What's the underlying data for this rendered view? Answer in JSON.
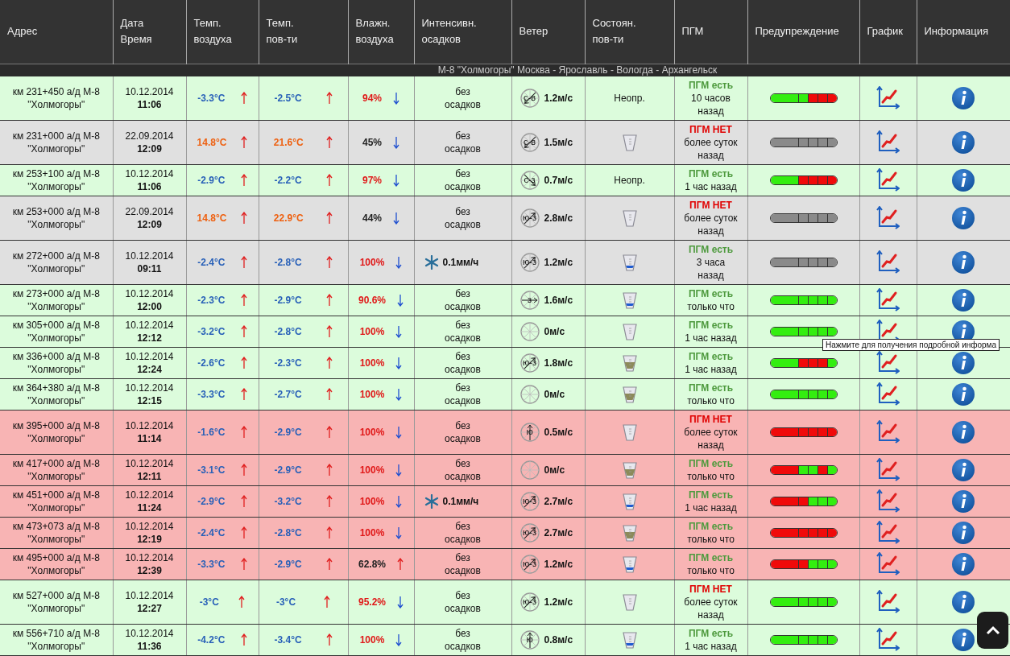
{
  "table": {
    "columns": [
      [
        "Адрес"
      ],
      [
        "Дата",
        "Время"
      ],
      [
        "Темп.",
        "воздуха"
      ],
      [
        "Темп.",
        "пов-ти"
      ],
      [
        "Влажн.",
        "воздуха"
      ],
      [
        "Интенсивн.",
        "осадков"
      ],
      [
        "Ветер"
      ],
      [
        "Состоян.",
        "пов-ти"
      ],
      [
        "ПГМ"
      ],
      [
        "Предупреждение"
      ],
      [
        "График"
      ],
      [
        "Информация"
      ]
    ],
    "group_title": "М-8 \"Холмогоры\" Москва - Ярославль - Вологда - Архангельск",
    "rows": [
      {
        "color": "#dcfcdc",
        "address": [
          "км 231+450 а/д М-8",
          "\"Холмогоры\""
        ],
        "date": "10.12.2014",
        "time": "11:06",
        "air": {
          "value": "-3.3°C",
          "warm": false,
          "rising": true
        },
        "road": {
          "value": "-2.5°C",
          "warm": false,
          "rising": true
        },
        "humidity": {
          "value": "94%",
          "high": true,
          "rising": false
        },
        "precip": {
          "kind": "none",
          "lines": [
            "без",
            "осадков"
          ]
        },
        "wind": {
          "direction": "с-в",
          "kind": "sw",
          "speed": "1.2м/с"
        },
        "surface": {
          "kind": "unknown",
          "text": "Неопр."
        },
        "pgm": {
          "present": true,
          "label": "ПГМ есть",
          "ago": [
            "10 часов",
            "назад"
          ]
        },
        "warning": [
          {
            "color": "#33ee10"
          },
          {
            "color": "#33ee10"
          },
          {
            "color": "#f00a0a"
          },
          {
            "color": "#f00a0a"
          },
          {
            "color": "#f00a0a"
          }
        ]
      },
      {
        "color": "#e0e0e0",
        "address": [
          "км 231+000 а/д М-8",
          "\"Холмогоры\""
        ],
        "date": "22.09.2014",
        "time": "12:09",
        "air": {
          "value": "14.8°C",
          "warm": true,
          "rising": true
        },
        "road": {
          "value": "21.6°C",
          "warm": true,
          "rising": true
        },
        "humidity": {
          "value": "45%",
          "high": false,
          "rising": false
        },
        "precip": {
          "kind": "none",
          "lines": [
            "без",
            "осадков"
          ]
        },
        "wind": {
          "direction": "с-в",
          "kind": "sw",
          "speed": "1.5м/с"
        },
        "surface": {
          "kind": "dry"
        },
        "pgm": {
          "present": false,
          "label": "ПГМ НЕТ",
          "ago": [
            "более суток",
            "назад"
          ]
        },
        "warning": [
          {
            "color": "#8a8a8a"
          },
          {
            "color": "#8a8a8a"
          },
          {
            "color": "#8a8a8a"
          },
          {
            "color": "#8a8a8a"
          },
          {
            "color": "#8a8a8a"
          }
        ]
      },
      {
        "color": "#dcfcdc",
        "address": [
          "км 253+100 а/д М-8",
          "\"Холмогоры\""
        ],
        "date": "10.12.2014",
        "time": "11:06",
        "air": {
          "value": "-2.9°C",
          "warm": false,
          "rising": true
        },
        "road": {
          "value": "-2.2°C",
          "warm": false,
          "rising": true
        },
        "humidity": {
          "value": "97%",
          "high": true,
          "rising": false
        },
        "precip": {
          "kind": "none",
          "lines": [
            "без",
            "осадков"
          ]
        },
        "wind": {
          "direction": "с-з",
          "kind": "se",
          "speed": "0.7м/с"
        },
        "surface": {
          "kind": "unknown",
          "text": "Неопр."
        },
        "pgm": {
          "present": true,
          "label": "ПГМ есть",
          "ago": [
            "1 час назад"
          ]
        },
        "warning": [
          {
            "color": "#33ee10"
          },
          {
            "color": "#f00a0a"
          },
          {
            "color": "#f00a0a"
          },
          {
            "color": "#f00a0a"
          },
          {
            "color": "#f00a0a"
          }
        ]
      },
      {
        "color": "#e0e0e0",
        "address": [
          "км 253+000 а/д М-8",
          "\"Холмогоры\""
        ],
        "date": "22.09.2014",
        "time": "12:09",
        "air": {
          "value": "14.8°C",
          "warm": true,
          "rising": true
        },
        "road": {
          "value": "22.9°C",
          "warm": true,
          "rising": true
        },
        "humidity": {
          "value": "44%",
          "high": false,
          "rising": false
        },
        "precip": {
          "kind": "none",
          "lines": [
            "без",
            "осадков"
          ]
        },
        "wind": {
          "direction": "ю-з",
          "kind": "ne",
          "speed": "2.8м/с"
        },
        "surface": {
          "kind": "dry"
        },
        "pgm": {
          "present": false,
          "label": "ПГМ НЕТ",
          "ago": [
            "более суток",
            "назад"
          ]
        },
        "warning": [
          {
            "color": "#8a8a8a"
          },
          {
            "color": "#8a8a8a"
          },
          {
            "color": "#8a8a8a"
          },
          {
            "color": "#8a8a8a"
          },
          {
            "color": "#8a8a8a"
          }
        ]
      },
      {
        "color": "#e0e0e0",
        "address": [
          "км 272+000 а/д М-8",
          "\"Холмогоры\""
        ],
        "date": "10.12.2014",
        "time": "09:11",
        "air": {
          "value": "-2.4°C",
          "warm": false,
          "rising": true
        },
        "road": {
          "value": "-2.8°C",
          "warm": false,
          "rising": true
        },
        "humidity": {
          "value": "100%",
          "high": true,
          "rising": false
        },
        "precip": {
          "kind": "snow",
          "lines": [
            "0.1мм/ч"
          ]
        },
        "wind": {
          "direction": "ю-з",
          "kind": "ne",
          "speed": "1.2м/с"
        },
        "surface": {
          "kind": "wet"
        },
        "pgm": {
          "present": true,
          "label": "ПГМ есть",
          "ago": [
            "3 часа",
            "назад"
          ]
        },
        "warning": [
          {
            "color": "#8a8a8a"
          },
          {
            "color": "#8a8a8a"
          },
          {
            "color": "#8a8a8a"
          },
          {
            "color": "#8a8a8a"
          },
          {
            "color": "#8a8a8a"
          }
        ]
      },
      {
        "color": "#dcfcdc",
        "address": [
          "км 273+000 а/д М-8",
          "\"Холмогоры\""
        ],
        "date": "10.12.2014",
        "time": "12:00",
        "air": {
          "value": "-2.3°C",
          "warm": false,
          "rising": true
        },
        "road": {
          "value": "-2.9°C",
          "warm": false,
          "rising": true
        },
        "humidity": {
          "value": "90.6%",
          "high": true,
          "rising": false
        },
        "precip": {
          "kind": "none",
          "lines": [
            "без",
            "осадков"
          ]
        },
        "wind": {
          "direction": "з",
          "kind": "e",
          "speed": "1.6м/с"
        },
        "surface": {
          "kind": "wet"
        },
        "pgm": {
          "present": true,
          "label": "ПГМ есть",
          "ago": [
            "только что"
          ]
        },
        "warning": [
          {
            "color": "#33ee10"
          },
          {
            "color": "#33ee10"
          },
          {
            "color": "#33ee10"
          },
          {
            "color": "#33ee10"
          },
          {
            "color": "#33ee10"
          }
        ]
      },
      {
        "color": "#dcfcdc",
        "address": [
          "км 305+000 а/д М-8",
          "\"Холмогоры\""
        ],
        "date": "10.12.2014",
        "time": "12:12",
        "air": {
          "value": "-3.2°C",
          "warm": false,
          "rising": true
        },
        "road": {
          "value": "-2.8°C",
          "warm": false,
          "rising": true
        },
        "humidity": {
          "value": "100%",
          "high": true,
          "rising": false
        },
        "precip": {
          "kind": "none",
          "lines": [
            "без",
            "осадков"
          ]
        },
        "wind": {
          "speed": "0м/с"
        },
        "surface": {
          "kind": "dry"
        },
        "pgm": {
          "present": true,
          "label": "ПГМ есть",
          "ago": [
            "1 час назад"
          ]
        },
        "warning": [
          {
            "color": "#33ee10"
          },
          {
            "color": "#33ee10"
          },
          {
            "color": "#33ee10"
          },
          {
            "color": "#33ee10"
          },
          {
            "color": "#33ee10"
          }
        ]
      },
      {
        "color": "#dcfcdc",
        "address": [
          "км 336+000 а/д М-8",
          "\"Холмогоры\""
        ],
        "date": "10.12.2014",
        "time": "12:24",
        "air": {
          "value": "-2.6°C",
          "warm": false,
          "rising": true
        },
        "road": {
          "value": "-2.3°C",
          "warm": false,
          "rising": true
        },
        "humidity": {
          "value": "100%",
          "high": true,
          "rising": false
        },
        "precip": {
          "kind": "none",
          "lines": [
            "без",
            "осадков"
          ]
        },
        "wind": {
          "direction": "ю-з",
          "kind": "ne",
          "speed": "1.8м/с"
        },
        "surface": {
          "kind": "dirt"
        },
        "pgm": {
          "present": true,
          "label": "ПГМ есть",
          "ago": [
            "1 час назад"
          ]
        },
        "warning": [
          {
            "color": "#33ee10"
          },
          {
            "color": "#f00a0a"
          },
          {
            "color": "#f00a0a"
          },
          {
            "color": "#f00a0a"
          },
          {
            "color": "#33ee10"
          }
        ]
      },
      {
        "color": "#dcfcdc",
        "address": [
          "км 364+380 а/д М-8",
          "\"Холмогоры\""
        ],
        "date": "10.12.2014",
        "time": "12:15",
        "air": {
          "value": "-3.3°C",
          "warm": false,
          "rising": true
        },
        "road": {
          "value": "-2.7°C",
          "warm": false,
          "rising": true
        },
        "humidity": {
          "value": "100%",
          "high": true,
          "rising": false
        },
        "precip": {
          "kind": "none",
          "lines": [
            "без",
            "осадков"
          ]
        },
        "wind": {
          "speed": "0м/с"
        },
        "surface": {
          "kind": "dirt"
        },
        "pgm": {
          "present": true,
          "label": "ПГМ есть",
          "ago": [
            "только что"
          ]
        },
        "warning": [
          {
            "color": "#33ee10"
          },
          {
            "color": "#33ee10"
          },
          {
            "color": "#33ee10"
          },
          {
            "color": "#33ee10"
          },
          {
            "color": "#33ee10"
          }
        ]
      },
      {
        "color": "#f8b4b4",
        "address": [
          "км 395+000 а/д М-8",
          "\"Холмогоры\""
        ],
        "date": "10.12.2014",
        "time": "11:14",
        "air": {
          "value": "-1.6°C",
          "warm": false,
          "rising": true
        },
        "road": {
          "value": "-2.9°C",
          "warm": false,
          "rising": true
        },
        "humidity": {
          "value": "100%",
          "high": true,
          "rising": false
        },
        "precip": {
          "kind": "none",
          "lines": [
            "без",
            "осадков"
          ]
        },
        "wind": {
          "direction": "ю",
          "kind": "n",
          "speed": "0.5м/с"
        },
        "surface": {
          "kind": "dry"
        },
        "pgm": {
          "present": false,
          "label": "ПГМ НЕТ",
          "ago": [
            "более суток",
            "назад"
          ]
        },
        "warning": [
          {
            "color": "#f00a0a"
          },
          {
            "color": "#f00a0a"
          },
          {
            "color": "#f00a0a"
          },
          {
            "color": "#f00a0a"
          },
          {
            "color": "#f00a0a"
          }
        ]
      },
      {
        "color": "#f8b4b4",
        "address": [
          "км 417+000 а/д М-8",
          "\"Холмогоры\""
        ],
        "date": "10.12.2014",
        "time": "12:11",
        "air": {
          "value": "-3.1°C",
          "warm": false,
          "rising": true
        },
        "road": {
          "value": "-2.9°C",
          "warm": false,
          "rising": true
        },
        "humidity": {
          "value": "100%",
          "high": true,
          "rising": false
        },
        "precip": {
          "kind": "none",
          "lines": [
            "без",
            "осадков"
          ]
        },
        "wind": {
          "speed": "0м/с"
        },
        "surface": {
          "kind": "dirt"
        },
        "pgm": {
          "present": true,
          "label": "ПГМ есть",
          "ago": [
            "только что"
          ]
        },
        "warning": [
          {
            "color": "#f00a0a"
          },
          {
            "color": "#33ee10"
          },
          {
            "color": "#33ee10"
          },
          {
            "color": "#f00a0a"
          },
          {
            "color": "#33ee10"
          }
        ]
      },
      {
        "color": "#f8b4b4",
        "address": [
          "км 451+000 а/д М-8",
          "\"Холмогоры\""
        ],
        "date": "10.12.2014",
        "time": "11:24",
        "air": {
          "value": "-2.9°C",
          "warm": false,
          "rising": true
        },
        "road": {
          "value": "-3.2°C",
          "warm": false,
          "rising": true
        },
        "humidity": {
          "value": "100%",
          "high": true,
          "rising": false
        },
        "precip": {
          "kind": "snow",
          "lines": [
            "0.1мм/ч"
          ]
        },
        "wind": {
          "direction": "ю-з",
          "kind": "ne",
          "speed": "2.7м/с"
        },
        "surface": {
          "kind": "wet"
        },
        "pgm": {
          "present": true,
          "label": "ПГМ есть",
          "ago": [
            "1 час назад"
          ]
        },
        "warning": [
          {
            "color": "#f00a0a"
          },
          {
            "color": "#f00a0a"
          },
          {
            "color": "#33ee10"
          },
          {
            "color": "#33ee10"
          },
          {
            "color": "#33ee10"
          }
        ]
      },
      {
        "color": "#f8b4b4",
        "address": [
          "км 473+073 а/д М-8",
          "\"Холмогоры\""
        ],
        "date": "10.12.2014",
        "time": "12:19",
        "air": {
          "value": "-2.4°C",
          "warm": false,
          "rising": true
        },
        "road": {
          "value": "-2.8°C",
          "warm": false,
          "rising": true
        },
        "humidity": {
          "value": "100%",
          "high": true,
          "rising": false
        },
        "precip": {
          "kind": "none",
          "lines": [
            "без",
            "осадков"
          ]
        },
        "wind": {
          "direction": "ю-з",
          "kind": "ne",
          "speed": "2.7м/с"
        },
        "surface": {
          "kind": "dirt"
        },
        "pgm": {
          "present": true,
          "label": "ПГМ есть",
          "ago": [
            "только что"
          ]
        },
        "warning": [
          {
            "color": "#f00a0a"
          },
          {
            "color": "#f00a0a"
          },
          {
            "color": "#f00a0a"
          },
          {
            "color": "#f00a0a"
          },
          {
            "color": "#f00a0a"
          }
        ]
      },
      {
        "color": "#f8b4b4",
        "address": [
          "км 495+000 а/д М-8",
          "\"Холмогоры\""
        ],
        "date": "10.12.2014",
        "time": "12:39",
        "air": {
          "value": "-3.3°C",
          "warm": false,
          "rising": true
        },
        "road": {
          "value": "-2.9°C",
          "warm": false,
          "rising": true
        },
        "humidity": {
          "value": "62.8%",
          "high": false,
          "rising": true
        },
        "precip": {
          "kind": "none",
          "lines": [
            "без",
            "осадков"
          ]
        },
        "wind": {
          "direction": "ю-з",
          "kind": "ne",
          "speed": "1.2м/с"
        },
        "surface": {
          "kind": "wet"
        },
        "pgm": {
          "present": true,
          "label": "ПГМ есть",
          "ago": [
            "только что"
          ]
        },
        "warning": [
          {
            "color": "#f00a0a"
          },
          {
            "color": "#f00a0a"
          },
          {
            "color": "#33ee10"
          },
          {
            "color": "#33ee10"
          },
          {
            "color": "#33ee10"
          }
        ]
      },
      {
        "color": "#dcfcdc",
        "address": [
          "км 527+000 а/д М-8",
          "\"Холмогоры\""
        ],
        "date": "10.12.2014",
        "time": "12:27",
        "air": {
          "value": "-3°C",
          "warm": false,
          "rising": true
        },
        "road": {
          "value": "-3°C",
          "warm": false,
          "rising": true
        },
        "humidity": {
          "value": "95.2%",
          "high": true,
          "rising": false
        },
        "precip": {
          "kind": "none",
          "lines": [
            "без",
            "осадков"
          ]
        },
        "wind": {
          "direction": "ю-з",
          "kind": "ne",
          "speed": "1.2м/с"
        },
        "surface": {
          "kind": "dry"
        },
        "pgm": {
          "present": false,
          "label": "ПГМ НЕТ",
          "ago": [
            "более суток",
            "назад"
          ]
        },
        "warning": [
          {
            "color": "#33ee10"
          },
          {
            "color": "#33ee10"
          },
          {
            "color": "#33ee10"
          },
          {
            "color": "#33ee10"
          },
          {
            "color": "#33ee10"
          }
        ]
      },
      {
        "color": "#dcfcdc",
        "address": [
          "км 556+710 а/д М-8",
          "\"Холмогоры\""
        ],
        "date": "10.12.2014",
        "time": "11:36",
        "air": {
          "value": "-4.2°C",
          "warm": false,
          "rising": true
        },
        "road": {
          "value": "-3.4°C",
          "warm": false,
          "rising": true
        },
        "humidity": {
          "value": "100%",
          "high": true,
          "rising": false
        },
        "precip": {
          "kind": "none",
          "lines": [
            "без",
            "осадков"
          ]
        },
        "wind": {
          "direction": "ю",
          "kind": "n",
          "speed": "0.8м/с"
        },
        "surface": {
          "kind": "wet"
        },
        "pgm": {
          "present": true,
          "label": "ПГМ есть",
          "ago": [
            "1 час назад"
          ]
        },
        "warning": [
          {
            "color": "#33ee10"
          },
          {
            "color": "#33ee10"
          },
          {
            "color": "#33ee10"
          },
          {
            "color": "#33ee10"
          },
          {
            "color": "#33ee10"
          }
        ]
      }
    ]
  },
  "tooltip": {
    "text": "Нажмите для получения подробной информа"
  }
}
